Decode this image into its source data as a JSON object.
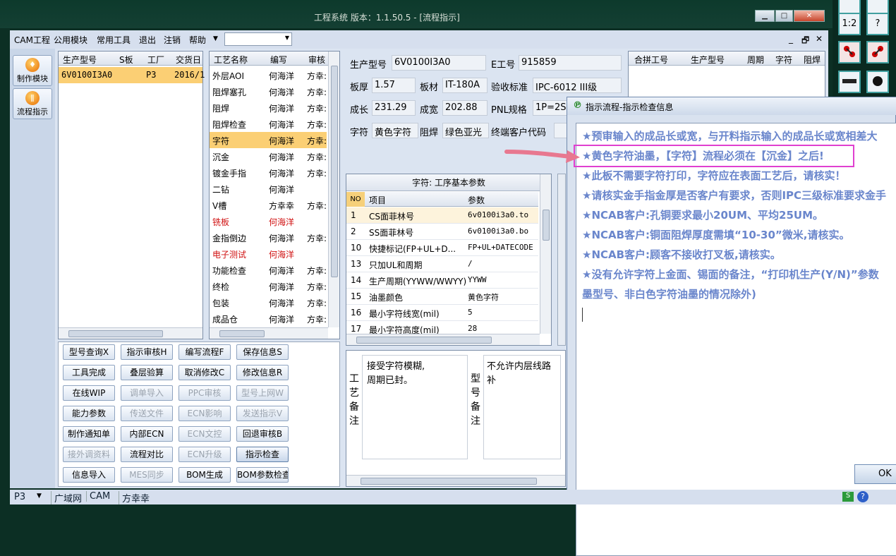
{
  "window": {
    "title": "工程系统  版本：1.1.50.5 - [流程指示]",
    "minimize": "▁",
    "maximize": "□",
    "close": "✕"
  },
  "menu": {
    "items": [
      "CAM工程",
      "公用模块",
      "常用工具",
      "退出",
      "注销",
      "帮助"
    ],
    "mdi_controls": [
      "_",
      "🗗",
      "✕"
    ]
  },
  "sidebar": {
    "buttons": [
      "制作模块",
      "流程指示"
    ]
  },
  "models_table": {
    "headers": [
      "生产型号",
      "S板",
      "工厂",
      "交货日"
    ],
    "rows": [
      {
        "model": "6V0100I3A0",
        "factory": "P3",
        "date": "2016/1"
      }
    ]
  },
  "process_table": {
    "headers": [
      "工艺名称",
      "编写",
      "审核"
    ],
    "rows": [
      {
        "name": "外层AOI",
        "writer": "何海洋",
        "reviewer": "方幸:",
        "red": false,
        "selected": false
      },
      {
        "name": "阻焊塞孔",
        "writer": "何海洋",
        "reviewer": "方幸:",
        "red": false,
        "selected": false
      },
      {
        "name": "阻焊",
        "writer": "何海洋",
        "reviewer": "方幸:",
        "red": false,
        "selected": false
      },
      {
        "name": "阻焊检查",
        "writer": "何海洋",
        "reviewer": "方幸:",
        "red": false,
        "selected": false
      },
      {
        "name": "字符",
        "writer": "何海洋",
        "reviewer": "方幸:",
        "red": false,
        "selected": true
      },
      {
        "name": "沉金",
        "writer": "何海洋",
        "reviewer": "方幸:",
        "red": false,
        "selected": false
      },
      {
        "name": "镀金手指",
        "writer": "何海洋",
        "reviewer": "方幸:",
        "red": false,
        "selected": false
      },
      {
        "name": "二钻",
        "writer": "何海洋",
        "reviewer": "",
        "red": false,
        "selected": false
      },
      {
        "name": "V槽",
        "writer": "方幸幸",
        "reviewer": "方幸:",
        "red": false,
        "selected": false
      },
      {
        "name": "铣板",
        "writer": "何海洋",
        "reviewer": "",
        "red": true,
        "selected": false
      },
      {
        "name": "金指倒边",
        "writer": "何海洋",
        "reviewer": "方幸:",
        "red": false,
        "selected": false
      },
      {
        "name": "电子测试",
        "writer": "何海洋",
        "reviewer": "",
        "red": true,
        "selected": false
      },
      {
        "name": "功能检查",
        "writer": "何海洋",
        "reviewer": "方幸:",
        "red": false,
        "selected": false
      },
      {
        "name": "终检",
        "writer": "何海洋",
        "reviewer": "方幸:",
        "red": false,
        "selected": false
      },
      {
        "name": "包装",
        "writer": "何海洋",
        "reviewer": "方幸:",
        "red": false,
        "selected": false
      },
      {
        "name": "成品仓",
        "writer": "何海洋",
        "reviewer": "方幸:",
        "red": false,
        "selected": false
      }
    ]
  },
  "function_buttons": [
    [
      {
        "label": "型号查询X",
        "enabled": true
      },
      {
        "label": "指示审核H",
        "enabled": true
      },
      {
        "label": "编写流程F",
        "enabled": true
      },
      {
        "label": "保存信息S",
        "enabled": true
      }
    ],
    [
      {
        "label": "工具完成",
        "enabled": true
      },
      {
        "label": "叠层验算",
        "enabled": true
      },
      {
        "label": "取消修改C",
        "enabled": true
      },
      {
        "label": "修改信息R",
        "enabled": true
      }
    ],
    [
      {
        "label": "在线WIP",
        "enabled": true
      },
      {
        "label": "调单导入",
        "enabled": false
      },
      {
        "label": "PPC审核",
        "enabled": false
      },
      {
        "label": "型号上网W",
        "enabled": false
      }
    ],
    [
      {
        "label": "能力参数",
        "enabled": true
      },
      {
        "label": "传送文件",
        "enabled": false
      },
      {
        "label": "ECN影响",
        "enabled": false
      },
      {
        "label": "发送指示V",
        "enabled": false
      }
    ],
    [
      {
        "label": "制作通知单",
        "enabled": true
      },
      {
        "label": "内部ECN",
        "enabled": true
      },
      {
        "label": "ECN文控",
        "enabled": false
      },
      {
        "label": "回退审核B",
        "enabled": true
      }
    ],
    [
      {
        "label": "接外调资料",
        "enabled": false
      },
      {
        "label": "流程对比",
        "enabled": true
      },
      {
        "label": "ECN升级",
        "enabled": false
      },
      {
        "label": "指示检查",
        "enabled": true
      }
    ],
    [
      {
        "label": "信息导入",
        "enabled": true
      },
      {
        "label": "MES同步",
        "enabled": false
      },
      {
        "label": "BOM生成",
        "enabled": true
      },
      {
        "label": "BOM参数检查",
        "enabled": true
      }
    ]
  ],
  "info": {
    "model_label": "生产型号",
    "model_value": "6V0100I3A0",
    "eno_label": "E工号",
    "eno_value": "915859",
    "thickness_label": "板厚",
    "thickness_value": "1.57",
    "material_label": "板材",
    "material_value": "IT-180A",
    "standard_label": "验收标准",
    "standard_value": "IPC-6012 III级",
    "length_label": "成长",
    "length_value": "231.29",
    "width_label": "成宽",
    "width_value": "202.88",
    "pnl_label": "PNL规格",
    "pnl_value": "1P=2S",
    "char_label": "字符",
    "char_value": "黄色字符",
    "mask_label": "阻焊",
    "mask_value": "绿色亚光",
    "customer_label": "终端客户代码",
    "customer_value": ""
  },
  "merge_table": {
    "headers": [
      "合拼工号",
      "生产型号",
      "周期",
      "字符",
      "阻焊"
    ]
  },
  "param_panel": {
    "title": "字符: 工序基本参数",
    "headers": [
      "NO",
      "项目",
      "参数"
    ],
    "rows": [
      {
        "no": "1",
        "item": "CS面菲林号",
        "value": "6v0100i3a0.to"
      },
      {
        "no": "2",
        "item": "SS面菲林号",
        "value": "6v0100i3a0.bo"
      },
      {
        "no": "10",
        "item": "快捷标记(FP+UL+D...",
        "value": "FP+UL+DATECODE"
      },
      {
        "no": "13",
        "item": "只加UL和周期",
        "value": "/"
      },
      {
        "no": "14",
        "item": "生产周期(YYWW/WWYY)",
        "value": "YYWW"
      },
      {
        "no": "15",
        "item": "油墨颜色",
        "value": "黄色字符"
      },
      {
        "no": "16",
        "item": "最小字符线宽(mil)",
        "value": "5"
      },
      {
        "no": "17",
        "item": "最小字符高度(mil)",
        "value": "28"
      }
    ]
  },
  "notes": {
    "process_label": "工艺备注",
    "process_text_1": "接受字符模糊,",
    "process_text_2": "周期已封。",
    "model_label": "型号备注",
    "model_text_1": "不允许内层线路",
    "model_text_2": "补"
  },
  "dialog": {
    "title": "指示流程-指示检查信息",
    "messages": [
      "★预审输入的成品长或宽，与开料指示输入的成品长或宽相差大",
      "★黄色字符油墨，【字符】流程必须在【沉金】之后!",
      "★此板不需要字符打印，字符应在表面工艺后，请核实！",
      "★请核实金手指金厚是否客户有要求，否则IPC三级标准要求金手",
      "★NCAB客户:孔铜要求最小20UM、平均25UM。",
      "★NCAB客户:铜面阻焊厚度需填“10-30”微米,请核实。",
      "★NCAB客户:顾客不接收打叉板,请核实。",
      "★没有允许字符上金面、锡面的备注，“打印机生产(Y/N)”参数",
      "墨型号、非白色字符油墨的情况除外)"
    ],
    "ok_label": "OK"
  },
  "status": {
    "site": "P3",
    "items": [
      "广域网",
      "CAM",
      "方幸幸"
    ]
  },
  "toolbar_right": [
    "1:2",
    "?"
  ],
  "colors": {
    "highlight_box": "#e040d0",
    "arrow": "#e87890",
    "selected_row": "#fbcf74",
    "message_text": "#6a86cc"
  }
}
